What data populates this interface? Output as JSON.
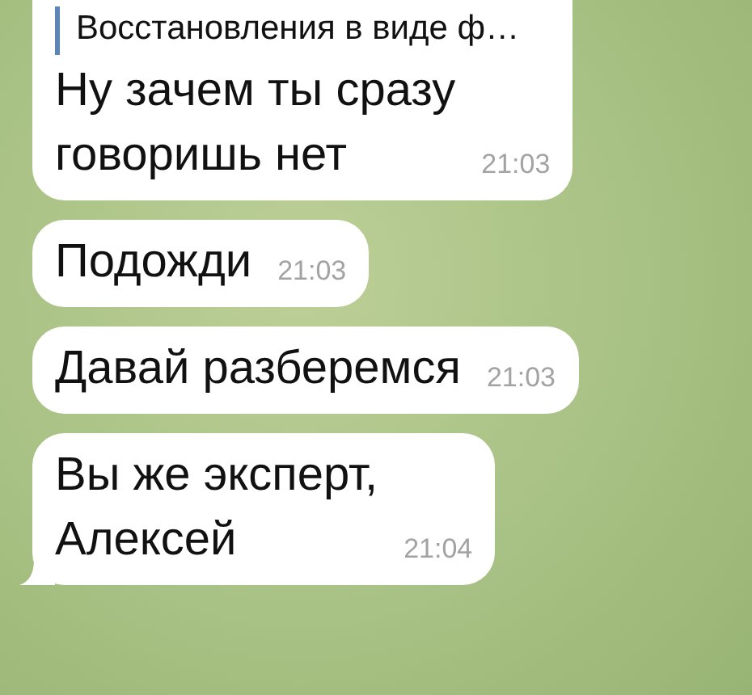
{
  "messages": [
    {
      "reply_quote": "Восстановления в виде ф…",
      "text": "Ну зачем ты сразу\nговоришь нет",
      "time": "21:03",
      "tail": false
    },
    {
      "text": "Подожди",
      "time": "21:03",
      "tail": false
    },
    {
      "text": "Давай разберемся",
      "time": "21:03",
      "tail": false
    },
    {
      "text": "Вы же эксперт,\nАлексей",
      "time": "21:04",
      "tail": true
    }
  ]
}
